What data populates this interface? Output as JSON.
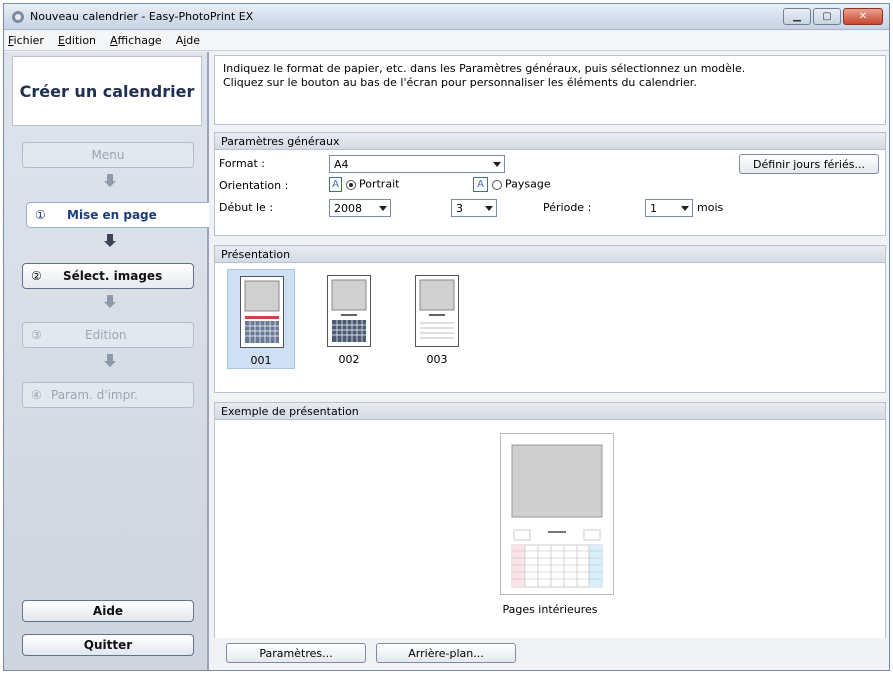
{
  "window": {
    "title": "Nouveau calendrier - Easy-PhotoPrint EX"
  },
  "menubar": {
    "items": [
      {
        "label": "Fichier",
        "accel": "F",
        "rest": "ichier"
      },
      {
        "label": "Edition",
        "accel": "E",
        "rest": "dition"
      },
      {
        "label": "Affichage",
        "accel": "A",
        "rest": "ffichage"
      },
      {
        "label": "Aide",
        "pre": "A",
        "accel": "i",
        "rest": "de"
      }
    ]
  },
  "sidebar": {
    "title": "Créer un calendrier",
    "steps": [
      {
        "num": "",
        "label": "Menu"
      },
      {
        "num": "①",
        "label": "Mise en page"
      },
      {
        "num": "②",
        "label": "Sélect. images"
      },
      {
        "num": "③",
        "label": "Edition"
      },
      {
        "num": "④",
        "label": "Param. d'impr."
      }
    ],
    "help_label": "Aide",
    "quit_label": "Quitter"
  },
  "instructions": {
    "line1": "Indiquez le format de papier, etc. dans les Paramètres généraux, puis sélectionnez un modèle.",
    "line2": "Cliquez sur le bouton au bas de l'écran pour personnaliser les éléments du calendrier."
  },
  "general": {
    "heading": "Paramètres généraux",
    "format_label": "Format :",
    "format_value": "A4",
    "holidays_button": "Définir jours fériés...",
    "orientation_label": "Orientation :",
    "portrait_label": "Portrait",
    "landscape_label": "Paysage",
    "orientation_selected": "Portrait",
    "start_label": "Début le :",
    "start_year": "2008",
    "start_month": "3",
    "period_label": "Période :",
    "period_value": "1",
    "period_unit": "mois"
  },
  "presentation": {
    "heading": "Présentation",
    "layouts": [
      {
        "id": "001",
        "selected": true
      },
      {
        "id": "002",
        "selected": false
      },
      {
        "id": "003",
        "selected": false
      }
    ]
  },
  "preview": {
    "heading": "Exemple de présentation",
    "caption": "Pages intérieures"
  },
  "footer": {
    "settings_button": "Paramètres...",
    "background_button": "Arrière-plan..."
  },
  "colors": {
    "accent": "#1d3c7a",
    "selection": "#cfe0f5"
  }
}
